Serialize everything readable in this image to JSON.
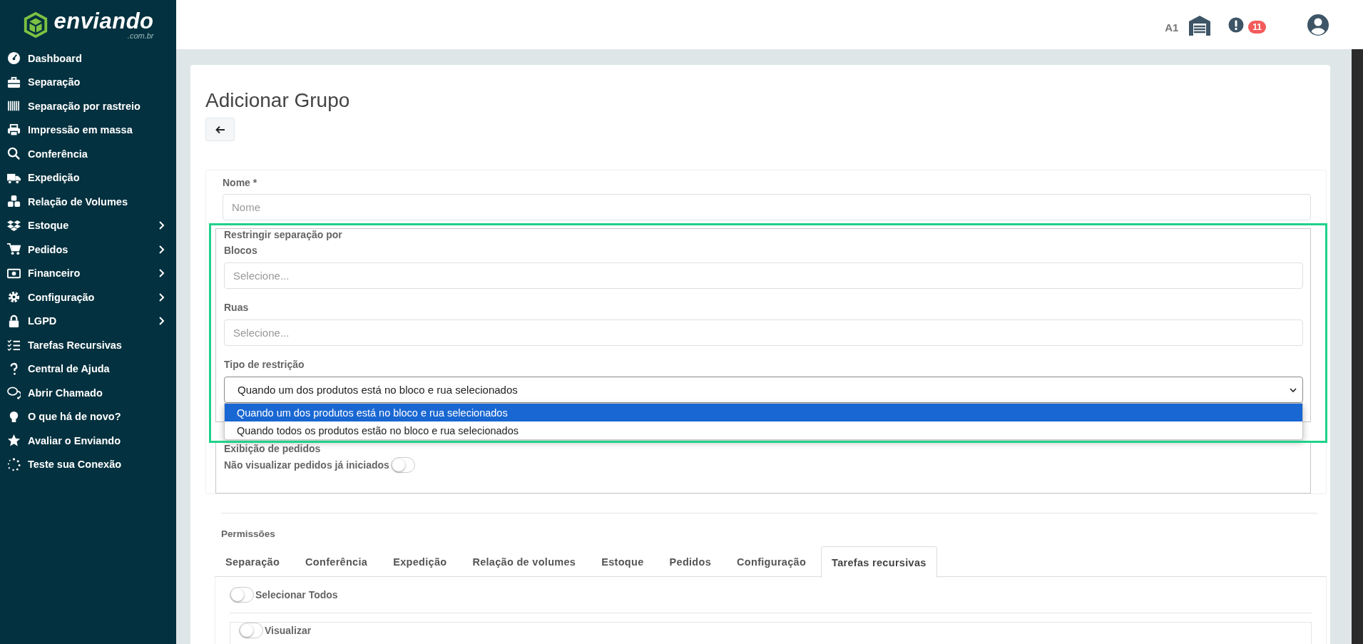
{
  "brand": {
    "name": "enviando",
    "domain": ".com.br"
  },
  "sidebar": {
    "items": [
      {
        "label": "Dashboard",
        "has_submenu": false
      },
      {
        "label": "Separação",
        "has_submenu": false
      },
      {
        "label": "Separação por rastreio",
        "has_submenu": false
      },
      {
        "label": "Impressão em massa",
        "has_submenu": false
      },
      {
        "label": "Conferência",
        "has_submenu": false
      },
      {
        "label": "Expedição",
        "has_submenu": false
      },
      {
        "label": "Relação de Volumes",
        "has_submenu": false
      },
      {
        "label": "Estoque",
        "has_submenu": true
      },
      {
        "label": "Pedidos",
        "has_submenu": true
      },
      {
        "label": "Financeiro",
        "has_submenu": true
      },
      {
        "label": "Configuração",
        "has_submenu": true
      },
      {
        "label": "LGPD",
        "has_submenu": true
      },
      {
        "label": "Tarefas Recursivas",
        "has_submenu": false
      },
      {
        "label": "Central de Ajuda",
        "has_submenu": false
      },
      {
        "label": "Abrir Chamado",
        "has_submenu": false
      },
      {
        "label": "O que há de novo?",
        "has_submenu": false
      },
      {
        "label": "Avaliar o Enviando",
        "has_submenu": false
      },
      {
        "label": "Teste sua Conexão",
        "has_submenu": false
      }
    ]
  },
  "topbar": {
    "warehouse": "A1",
    "notifications": "11"
  },
  "page": {
    "title": "Adicionar Grupo"
  },
  "form": {
    "name_label": "Nome *",
    "name_placeholder": "Nome",
    "restrict": {
      "legend": "Restringir separação por",
      "blocks": {
        "label": "Blocos",
        "placeholder": "Selecione..."
      },
      "streets": {
        "label": "Ruas",
        "placeholder": "Selecione..."
      },
      "type": {
        "label": "Tipo de restrição",
        "value": "Quando um dos produtos está no bloco e rua selecionados",
        "expanded": true,
        "options": [
          {
            "label": "Quando um dos produtos está no bloco e rua selecionados",
            "selected": true
          },
          {
            "label": "Quando todos os produtos estão no bloco e rua selecionados",
            "selected": false
          }
        ]
      }
    },
    "display": {
      "legend": "Exibição de pedidos",
      "toggle": {
        "label": "Não visualizar pedidos já iniciados",
        "on": false
      }
    }
  },
  "permissions": {
    "title": "Permissões",
    "tabs": [
      {
        "label": "Separação",
        "selected": false
      },
      {
        "label": "Conferência",
        "selected": false
      },
      {
        "label": "Expedição",
        "selected": false
      },
      {
        "label": "Relação de volumes",
        "selected": false
      },
      {
        "label": "Estoque",
        "selected": false
      },
      {
        "label": "Pedidos",
        "selected": false
      },
      {
        "label": "Configuração",
        "selected": false
      },
      {
        "label": "Tarefas recursivas",
        "selected": true
      }
    ],
    "select_all": {
      "label": "Selecionar Todos",
      "on": false
    },
    "items": [
      {
        "label": "Visualizar",
        "on": false
      }
    ]
  }
}
